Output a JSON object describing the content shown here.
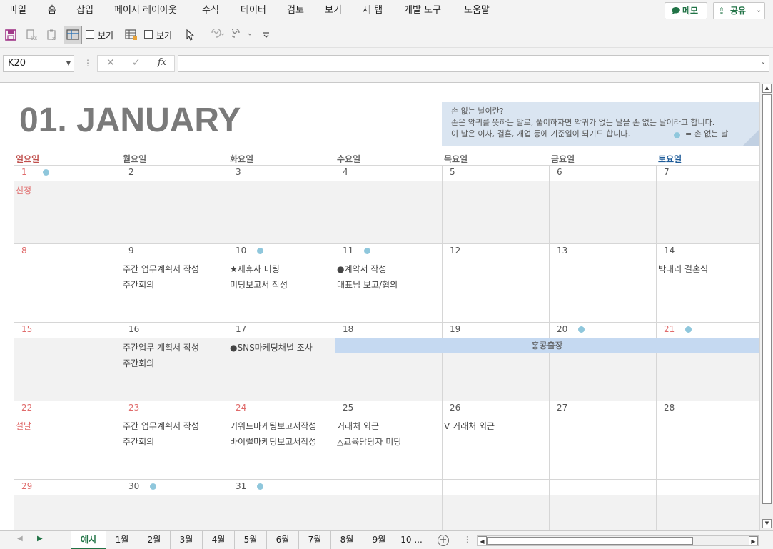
{
  "menu": {
    "items": [
      "파일",
      "홈",
      "삽입",
      "페이지 레이아웃",
      "수식",
      "데이터",
      "검토",
      "보기",
      "새 탭",
      "개발 도구",
      "도움말"
    ],
    "memo_label": "메모",
    "share_label": "공유"
  },
  "qat": {
    "view_label_1": "보기",
    "view_label_2": "보기"
  },
  "formula_bar": {
    "name_box": "K20",
    "cancel_glyph": "✕",
    "enter_glyph": "✓",
    "fx_glyph": "fx",
    "formula": ""
  },
  "calendar": {
    "title": "01. JANUARY",
    "info": {
      "line1": "손 없는 날이란?",
      "line2": "손은 악귀를 뜻하는 말로, 풀이하자면 악귀가 없는 날을 손 없는 날이라고 합니다.",
      "line3": "이 날은 이사, 결혼, 개업 등에 기준일이 되기도 합니다.",
      "legend": "= 손 없는 날"
    },
    "weekdays": [
      "일요일",
      "월요일",
      "화요일",
      "수요일",
      "목요일",
      "금요일",
      "토요일"
    ],
    "weekday_colors": {
      "sunday": "#c0504d",
      "saturday": "#1f5c99",
      "weekday": "#666666"
    },
    "lucky_dot_color": "#8fc7dc",
    "weeks": [
      [
        {
          "day": "1",
          "red": true,
          "dot": true,
          "events": [
            "신정"
          ],
          "event_red": true
        },
        {
          "day": "2",
          "events": []
        },
        {
          "day": "3",
          "events": []
        },
        {
          "day": "4",
          "events": []
        },
        {
          "day": "5",
          "events": []
        },
        {
          "day": "6",
          "events": []
        },
        {
          "day": "7",
          "events": []
        }
      ],
      [
        {
          "day": "8",
          "red": true,
          "events": []
        },
        {
          "day": "9",
          "events": [
            "주간 업무계획서 작성",
            "주간회의"
          ]
        },
        {
          "day": "10",
          "dot": true,
          "events": [
            "★제휴사 미팅",
            "미팅보고서 작성"
          ]
        },
        {
          "day": "11",
          "dot": true,
          "events": [
            "●계약서 작성",
            "대표님 보고/협의"
          ]
        },
        {
          "day": "12",
          "events": []
        },
        {
          "day": "13",
          "events": []
        },
        {
          "day": "14",
          "events": [
            "박대리 결혼식"
          ]
        }
      ],
      [
        {
          "day": "15",
          "red": true,
          "events": []
        },
        {
          "day": "16",
          "events": [
            "주간업무 계획서 작성",
            "주간회의"
          ]
        },
        {
          "day": "17",
          "events": [
            "●SNS마케팅채널 조사"
          ]
        },
        {
          "day": "18",
          "events": []
        },
        {
          "day": "19",
          "events": []
        },
        {
          "day": "20",
          "dot": true,
          "events": []
        },
        {
          "day": "21",
          "red": true,
          "dot": true,
          "events": []
        }
      ],
      [
        {
          "day": "22",
          "red": true,
          "events": [
            "설날"
          ],
          "event_red": true
        },
        {
          "day": "23",
          "red": true,
          "events": [
            "주간 업무계획서 작성",
            "주간회의"
          ]
        },
        {
          "day": "24",
          "red": true,
          "events": [
            "키워드마케팅보고서작성",
            "바이럴마케팅보고서작성"
          ]
        },
        {
          "day": "25",
          "events": [
            "거래처 외근",
            "△교육담당자 미팅"
          ]
        },
        {
          "day": "26",
          "events": [
            "V 거래처 외근"
          ]
        },
        {
          "day": "27",
          "events": []
        },
        {
          "day": "28",
          "events": []
        }
      ],
      [
        {
          "day": "29",
          "red": true,
          "events": []
        },
        {
          "day": "30",
          "dot": true,
          "events": []
        },
        {
          "day": "31",
          "dot": true,
          "events": []
        },
        {
          "day": "",
          "events": []
        },
        {
          "day": "",
          "events": []
        },
        {
          "day": "",
          "events": []
        },
        {
          "day": "",
          "events": []
        }
      ]
    ],
    "trip_label": "홍콩출장"
  },
  "sheet_tabs": [
    "예시",
    "1월",
    "2월",
    "3월",
    "4월",
    "5월",
    "6월",
    "7월",
    "8월",
    "9월",
    "10 ..."
  ],
  "active_tab": "예시"
}
